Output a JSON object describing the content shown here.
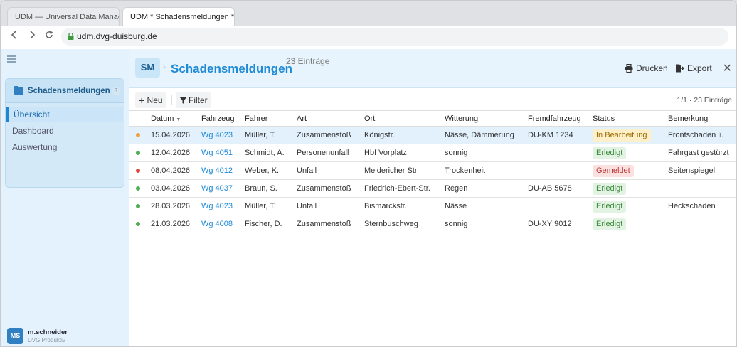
{
  "browser": {
    "tabs": [
      {
        "label": "UDM — Universal Data Manag..."
      },
      {
        "label": "UDM * Schadensmeldungen * dv"
      }
    ],
    "url": "udm.dvg-duisburg.de"
  },
  "sidebar": {
    "section_title": "Schadensmeldungen",
    "section_count": "3",
    "items": [
      {
        "label": "Übersicht",
        "active": true
      },
      {
        "label": "Dashboard",
        "active": false
      },
      {
        "label": "Auswertung",
        "active": false
      }
    ],
    "user": {
      "initials": "MS",
      "name": "m.schneider",
      "org": "DVG Produktiv"
    }
  },
  "header": {
    "badge": "SM",
    "title": "Schadensmeldungen",
    "count": "23 Einträge",
    "print_label": "Drucken",
    "export_label": "Export",
    "close_label": "✕"
  },
  "actions": {
    "new_label": "Neu",
    "filter_label": "Filter",
    "pager": "1/1 · 23 Einträge"
  },
  "table": {
    "columns": [
      "Datum",
      "Fahrzeug",
      "Fahrer",
      "Art",
      "Ort",
      "Witterung",
      "Fremdfahrzeug",
      "Status",
      "Bemerkung"
    ],
    "sort_indicator": "▼",
    "rows": [
      {
        "dot_color": "#f0a340",
        "datum": "15.04.2026",
        "fahrzeug": "Wg 4023",
        "fahrer": "Müller, T.",
        "art": "Zusammenstoß",
        "ort": "Königstr.",
        "witterung": "Nässe, Dämmerung",
        "fremd": "DU-KM 1234",
        "status": "In Bearbeitung",
        "status_type": "warn",
        "bemerkung": "Frontschaden li.",
        "selected": true
      },
      {
        "dot_color": "#4cb050",
        "datum": "12.04.2026",
        "fahrzeug": "Wg 4051",
        "fahrer": "Schmidt, A.",
        "art": "Personenunfall",
        "ort": "Hbf Vorplatz",
        "witterung": "sonnig",
        "fremd": "",
        "status": "Erledigt",
        "status_type": "ok",
        "bemerkung": "Fahrgast gestürzt",
        "selected": false
      },
      {
        "dot_color": "#e04545",
        "datum": "08.04.2026",
        "fahrzeug": "Wg 4012",
        "fahrer": "Weber, K.",
        "art": "Unfall",
        "ort": "Meidericher Str.",
        "witterung": "Trockenheit",
        "fremd": "",
        "status": "Gemeldet",
        "status_type": "err",
        "bemerkung": "Seitenspiegel",
        "selected": false
      },
      {
        "dot_color": "#4cb050",
        "datum": "03.04.2026",
        "fahrzeug": "Wg 4037",
        "fahrer": "Braun, S.",
        "art": "Zusammenstoß",
        "ort": "Friedrich-Ebert-Str.",
        "witterung": "Regen",
        "fremd": "DU-AB 5678",
        "status": "Erledigt",
        "status_type": "ok",
        "bemerkung": "",
        "selected": false
      },
      {
        "dot_color": "#4cb050",
        "datum": "28.03.2026",
        "fahrzeug": "Wg 4023",
        "fahrer": "Müller, T.",
        "art": "Unfall",
        "ort": "Bismarckstr.",
        "witterung": "Nässe",
        "fremd": "",
        "status": "Erledigt",
        "status_type": "ok",
        "bemerkung": "Heckschaden",
        "selected": false
      },
      {
        "dot_color": "#4cb050",
        "datum": "21.03.2026",
        "fahrzeug": "Wg 4008",
        "fahrer": "Fischer, D.",
        "art": "Zusammenstoß",
        "ort": "Sternbuschweg",
        "witterung": "sonnig",
        "fremd": "DU-XY 9012",
        "status": "Erledigt",
        "status_type": "ok",
        "bemerkung": "",
        "selected": false
      }
    ]
  },
  "colors": {
    "accent": "#1f8ad6",
    "badge_ok_bg": "#e3f3e3",
    "badge_ok_fg": "#3a8a3a",
    "badge_warn_bg": "#fdf0c8",
    "badge_warn_fg": "#9a6a00",
    "badge_err_bg": "#fbe0e0",
    "badge_err_fg": "#b83232"
  }
}
